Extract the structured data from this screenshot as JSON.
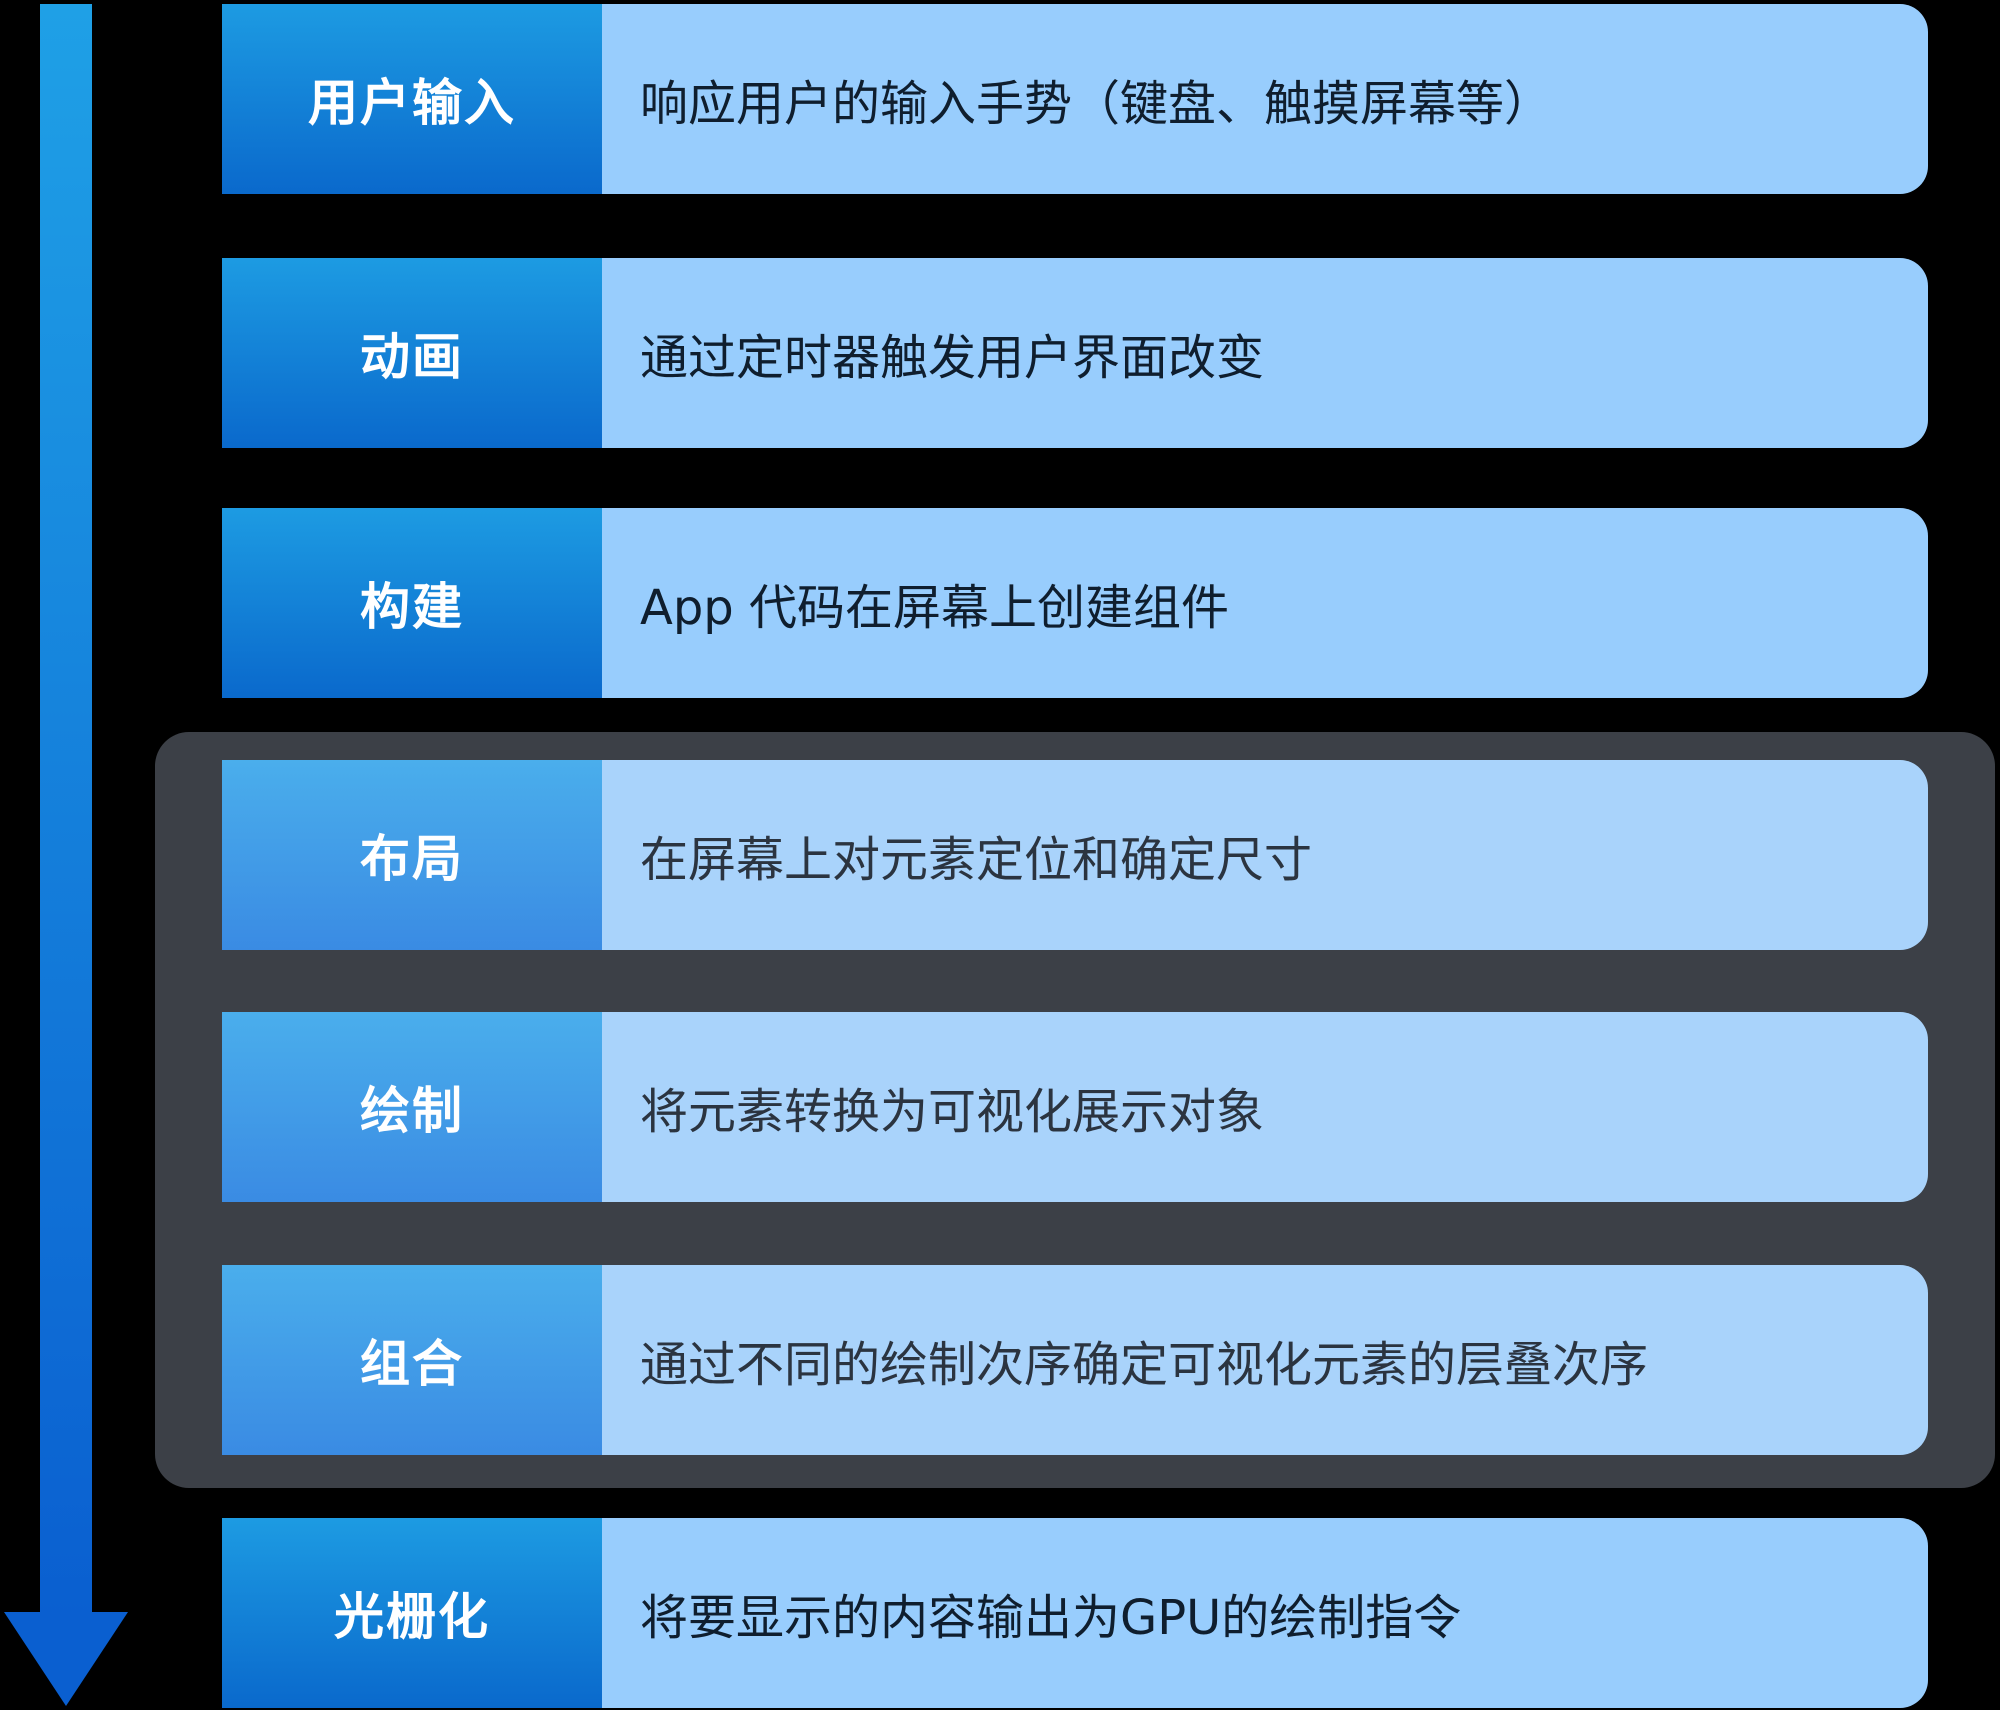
{
  "colors": {
    "background": "#000000",
    "arrow_top": "#1fa0e6",
    "arrow_bottom": "#0a5fd0",
    "label_top": "#1d9be2",
    "label_bottom": "#0a69cc",
    "description_fill": "#98cdfd",
    "group_fill": "#3c4047"
  },
  "stages": [
    {
      "label": "用户输入",
      "description": "响应用户的输入手势（键盘、触摸屏幕等）"
    },
    {
      "label": "动画",
      "description": "通过定时器触发用户界面改变"
    },
    {
      "label": "构建",
      "description": "App 代码在屏幕上创建组件"
    },
    {
      "label": "布局",
      "description": "在屏幕上对元素定位和确定尺寸"
    },
    {
      "label": "绘制",
      "description": "将元素转换为可视化展示对象"
    },
    {
      "label": "组合",
      "description": "通过不同的绘制次序确定可视化元素的层叠次序"
    },
    {
      "label": "光栅化",
      "description": "将要显示的内容输出为GPU的绘制指令"
    }
  ]
}
